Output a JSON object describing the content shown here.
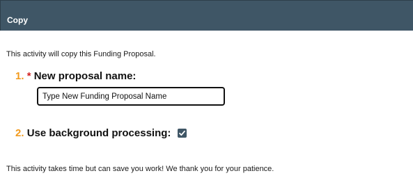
{
  "header": {
    "title": "Copy"
  },
  "intro_text": "This activity will copy this Funding Proposal.",
  "step1": {
    "number": "1.",
    "required_mark": "*",
    "label": "New proposal name:",
    "input_value": "Type New Funding Proposal Name"
  },
  "step2": {
    "number": "2.",
    "label": "Use background processing:",
    "checked": true
  },
  "outro_text": "This activity takes time but can save you work! We thank you for your patience.",
  "colors": {
    "header_bg": "#3f5666",
    "step_number": "#f29a1d",
    "required": "#d32323"
  },
  "icons": {
    "checkbox": "checkmark-icon"
  }
}
